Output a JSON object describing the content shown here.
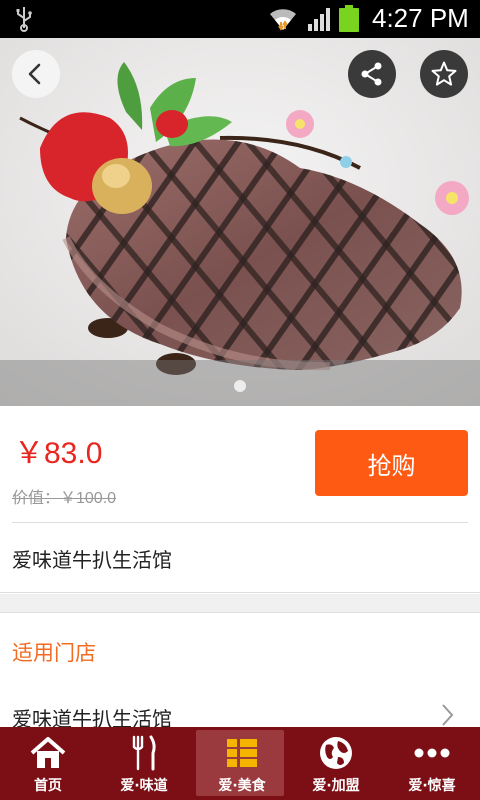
{
  "status_bar": {
    "time": "4:27 PM",
    "icons": [
      "usb-icon",
      "wifi-icon",
      "signal-icon",
      "battery-icon"
    ]
  },
  "hero": {
    "image": "grilled-steak-photo",
    "slide_count": 1,
    "buttons": {
      "back": "back-icon",
      "share": "share-icon",
      "favorite": "star-icon"
    }
  },
  "product": {
    "price": "￥83.0",
    "original_price": "价值：￥100.0",
    "buy_label": "抢购",
    "shop_name": "爱味道牛扒生活馆"
  },
  "stores": {
    "title": "适用门店",
    "items": [
      {
        "name": "爱味道牛扒生活馆"
      }
    ]
  },
  "tabs": [
    {
      "label": "首页",
      "icon": "home-icon",
      "active": false
    },
    {
      "label": "爱·味道",
      "icon": "fork-knife-icon",
      "active": false
    },
    {
      "label": "爱·美食",
      "icon": "grid-list-icon",
      "active": true
    },
    {
      "label": "爱·加盟",
      "icon": "globe-icon",
      "active": false
    },
    {
      "label": "爱·惊喜",
      "icon": "more-dots-icon",
      "active": false
    }
  ],
  "colors": {
    "price_red": "#e8251e",
    "buy_orange": "#ff5a14",
    "section_orange": "#f26b22",
    "tabbar_maroon": "#7c0f15",
    "tab_active": "#9b3a3e"
  }
}
